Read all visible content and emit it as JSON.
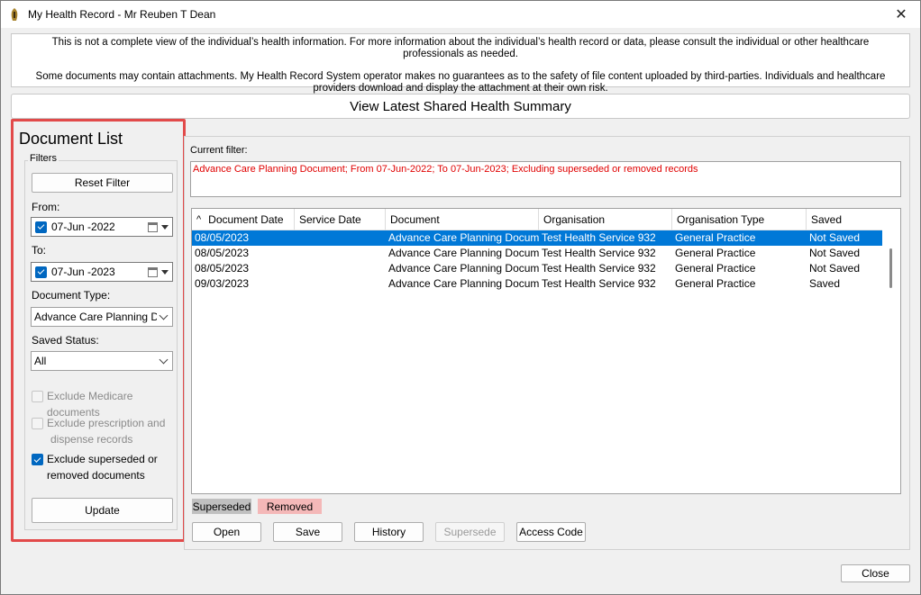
{
  "window": {
    "title": "My Health Record - Mr Reuben T Dean",
    "close_glyph": "✕"
  },
  "notice": {
    "line1": "This is not a complete view of the individual’s health information. For more information about the individual’s health record or data, please consult the individual or other healthcare professionals as needed.",
    "line2": "Some documents may contain attachments. My Health Record System operator makes no guarantees as to the safety of file content uploaded by third-parties. Individuals and healthcare providers download and display the attachment at their own risk."
  },
  "summary_button": "View Latest Shared Health Summary",
  "document_list": {
    "title": "Document List",
    "filters_legend": "Filters",
    "reset_filter": "Reset Filter",
    "from_label": "From:",
    "from_value": "07-Jun -2022",
    "to_label": "To:",
    "to_value": "07-Jun -2023",
    "document_type_label": "Document Type:",
    "document_type_value": "Advance Care Planning Document",
    "saved_status_label": "Saved Status:",
    "saved_status_value": "All",
    "exclude_medicare": "Exclude Medicare documents",
    "exclude_prescription_1": "Exclude prescription and",
    "exclude_prescription_2": "dispense records",
    "exclude_superseded_1": "Exclude superseded or",
    "exclude_superseded_2": "removed documents",
    "update": "Update"
  },
  "current_filter": {
    "label": "Current filter:",
    "text": "Advance Care Planning Document; From 07-Jun-2022; To 07-Jun-2023; Excluding superseded or removed records"
  },
  "table": {
    "sort_glyph": "^",
    "columns": [
      "Document Date",
      "Service Date",
      "Document",
      "Organisation",
      "Organisation Type",
      "Saved"
    ],
    "rows": [
      [
        "08/05/2023",
        "",
        "Advance Care Planning Document",
        "Test Health Service 932",
        "General Practice",
        "Not Saved"
      ],
      [
        "08/05/2023",
        "",
        "Advance Care Planning Document",
        "Test Health Service 932",
        "General Practice",
        "Not Saved"
      ],
      [
        "08/05/2023",
        "",
        "Advance Care Planning Document",
        "Test Health Service 932",
        "General Practice",
        "Not Saved"
      ],
      [
        "09/03/2023",
        "",
        "Advance Care Planning Document",
        "Test Health Service 932",
        "General Practice",
        "Saved"
      ]
    ]
  },
  "legend": {
    "superseded": "Superseded",
    "removed": "Removed",
    "superseded_color": "#c0c0c0",
    "removed_color": "#f4b8b8"
  },
  "actions": {
    "open": "Open",
    "save": "Save",
    "history": "History",
    "supersede": "Supersede",
    "access_code": "Access Code"
  },
  "close_button": "Close",
  "colors": {
    "selection": "#0078d7",
    "highlight_border": "#e24a4a",
    "filter_text": "#e00000"
  }
}
